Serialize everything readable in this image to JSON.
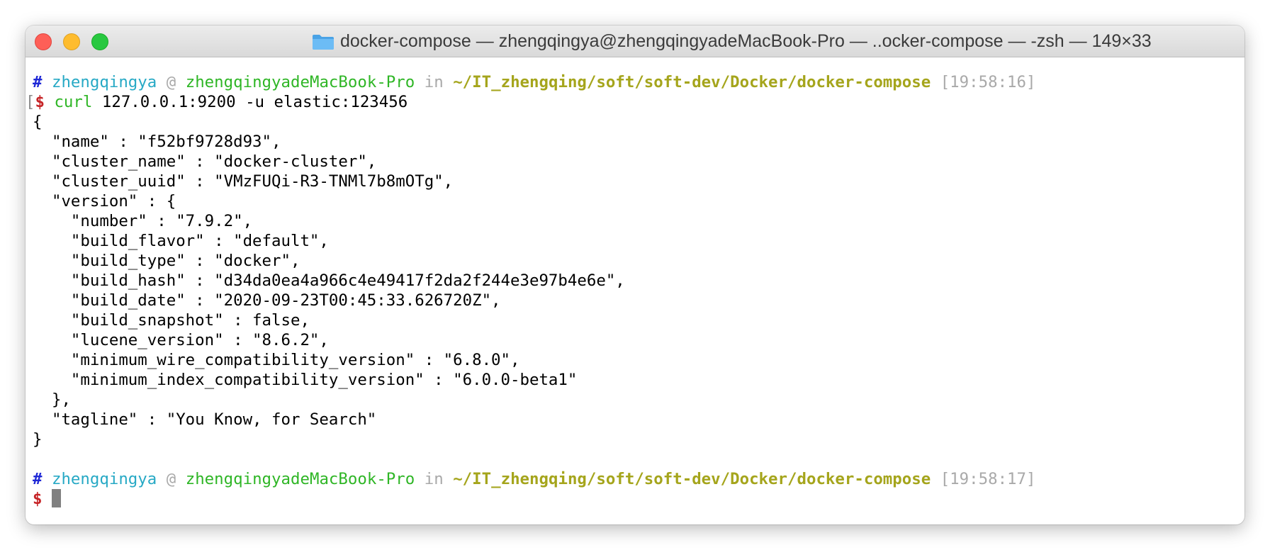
{
  "window": {
    "title": "docker-compose — zhengqingya@zhengqingyadeMacBook-Pro — ..ocker-compose — -zsh — 149×33",
    "title_icon": "folder-icon"
  },
  "colors": {
    "hash": "#1f28d6",
    "user": "#27a9c5",
    "host": "#2fb626",
    "path": "#a5a51c",
    "dollar": "#c62427",
    "dim": "#a9a9a9"
  },
  "prompt1": {
    "hash": "#",
    "user": "zhengqingya",
    "at": "@",
    "host": "zhengqingyadeMacBook-Pro",
    "in": "in",
    "path": "~/IT_zhengqing/soft/soft-dev/Docker/docker-compose",
    "time": "[19:58:16]"
  },
  "command_line": {
    "bracket": "[",
    "dollar": "$",
    "cmd": "curl",
    "args": "127.0.0.1:9200 -u elastic:123456"
  },
  "output": [
    "{",
    "  \"name\" : \"f52bf9728d93\",",
    "  \"cluster_name\" : \"docker-cluster\",",
    "  \"cluster_uuid\" : \"VMzFUQi-R3-TNMl7b8mOTg\",",
    "  \"version\" : {",
    "    \"number\" : \"7.9.2\",",
    "    \"build_flavor\" : \"default\",",
    "    \"build_type\" : \"docker\",",
    "    \"build_hash\" : \"d34da0ea4a966c4e49417f2da2f244e3e97b4e6e\",",
    "    \"build_date\" : \"2020-09-23T00:45:33.626720Z\",",
    "    \"build_snapshot\" : false,",
    "    \"lucene_version\" : \"8.6.2\",",
    "    \"minimum_wire_compatibility_version\" : \"6.8.0\",",
    "    \"minimum_index_compatibility_version\" : \"6.0.0-beta1\"",
    "  },",
    "  \"tagline\" : \"You Know, for Search\"",
    "}"
  ],
  "prompt2": {
    "hash": "#",
    "user": "zhengqingya",
    "at": "@",
    "host": "zhengqingyadeMacBook-Pro",
    "in": "in",
    "path": "~/IT_zhengqing/soft/soft-dev/Docker/docker-compose",
    "time": "[19:58:17]"
  },
  "input_line": {
    "dollar": "$"
  }
}
